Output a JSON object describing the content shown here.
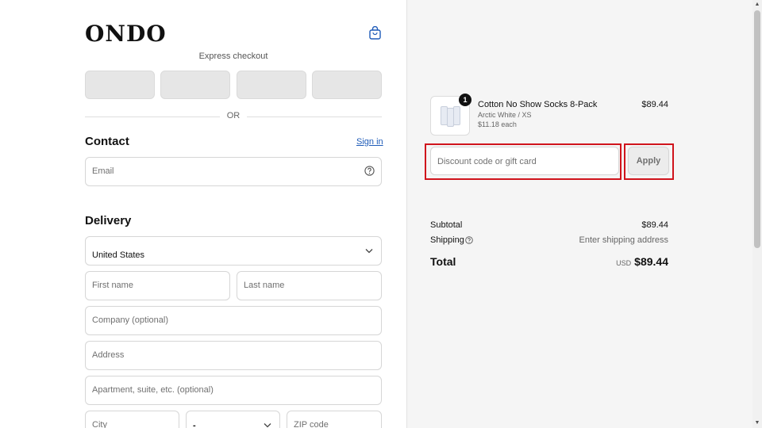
{
  "brand": {
    "logo": "ONDO"
  },
  "icons": {
    "cart": "shopping-bag-icon",
    "help": "question-circle-icon",
    "dropdown": "chevron-down-icon"
  },
  "express": {
    "label": "Express checkout",
    "divider": "OR"
  },
  "contact": {
    "title": "Contact",
    "sign_in": "Sign in",
    "email_placeholder": "Email"
  },
  "delivery": {
    "title": "Delivery",
    "country_value": "United States",
    "first_name": "First name",
    "last_name": "Last name",
    "company": "Company (optional)",
    "address": "Address",
    "apartment": "Apartment, suite, etc. (optional)",
    "city": "City",
    "state_value": "-",
    "zip": "ZIP code"
  },
  "order": {
    "item": {
      "name": "Cotton No Show Socks 8-Pack",
      "variant": "Arctic White / XS",
      "each": "$11.18 each",
      "price": "$89.44",
      "quantity": "1"
    },
    "discount_placeholder": "Discount code or gift card",
    "apply_label": "Apply",
    "subtotal_label": "Subtotal",
    "subtotal_value": "$89.44",
    "shipping_label": "Shipping",
    "shipping_value": "Enter shipping address",
    "total_label": "Total",
    "currency": "USD",
    "total_value": "$89.44"
  },
  "colors": {
    "link": "#1e5bb8",
    "highlight": "#d0141c",
    "summary_bg": "#f5f5f5"
  }
}
